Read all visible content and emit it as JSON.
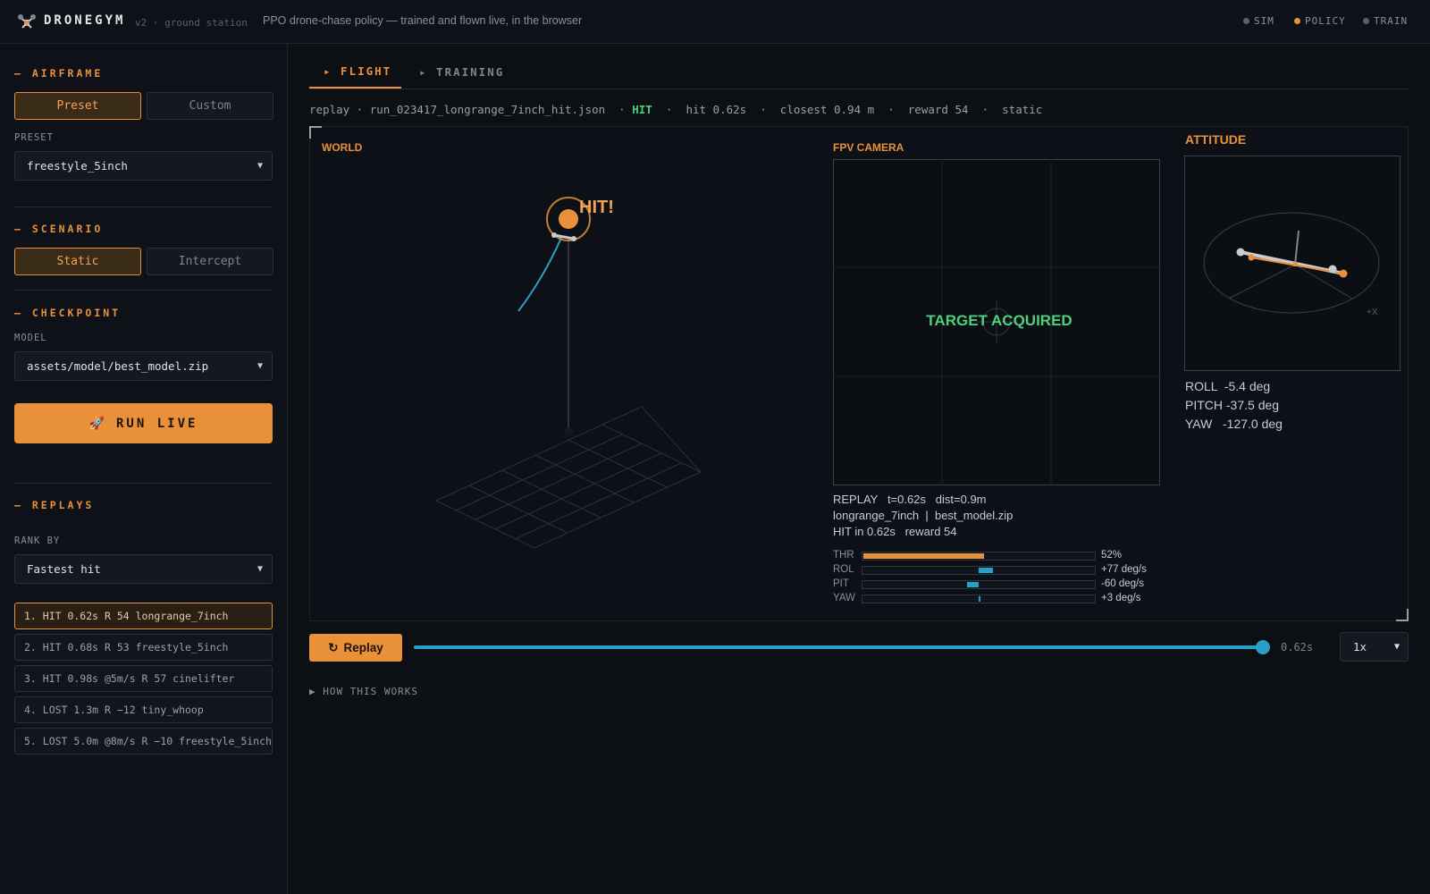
{
  "header": {
    "brand": "DRONEGYM",
    "version": "v2 · ground station",
    "tagline": "PPO drone-chase policy — trained and flown live, in the browser",
    "status": [
      {
        "label": "SIM",
        "color": "#5a616b"
      },
      {
        "label": "POLICY",
        "color": "#e8913a"
      },
      {
        "label": "TRAIN",
        "color": "#5a616b"
      }
    ]
  },
  "sidebar": {
    "airframe": {
      "title": "AIRFRAME",
      "preset_btn": "Preset",
      "custom_btn": "Custom",
      "preset_label": "PRESET",
      "preset_value": "freestyle_5inch"
    },
    "scenario": {
      "title": "SCENARIO",
      "static_btn": "Static",
      "intercept_btn": "Intercept"
    },
    "checkpoint": {
      "title": "CHECKPOINT",
      "model_label": "MODEL",
      "model_value": "assets/model/best_model.zip"
    },
    "run_live": "RUN LIVE",
    "replays": {
      "title": "REPLAYS",
      "rank_label": "RANK BY",
      "rank_value": "Fastest hit",
      "items": [
        "1. HIT 0.62s R 54 longrange_7inch",
        "2. HIT 0.68s R 53 freestyle_5inch",
        "3. HIT 0.98s @5m/s R 57 cinelifter",
        "4. LOST 1.3m R −12 tiny_whoop",
        "5. LOST 5.0m @8m/s R −10 freestyle_5inch"
      ]
    }
  },
  "main": {
    "tabs": [
      "▸ FLIGHT",
      "▸ TRAINING"
    ],
    "info": {
      "prefix": "replay · run_023417_longrange_7inch_hit.json  · ",
      "result": "HIT",
      "suffix": "  ·  hit 0.62s  ·  closest 0.94 m  ·  reward 54  ·  static"
    },
    "world": {
      "label": "WORLD",
      "hit_text": "HIT!"
    },
    "fpv": {
      "label": "FPV CAMERA",
      "acquired": "TARGET ACQUIRED",
      "line1": "REPLAY   t=0.62s   dist=0.9m",
      "line2": "longrange_7inch  |  best_model.zip",
      "line3": "HIT in 0.62s   reward 54",
      "bars": [
        {
          "label": "THR",
          "value": "52%",
          "fraction": 0.52,
          "centered": false,
          "color": "#e8913a"
        },
        {
          "label": "ROL",
          "value": "+77 deg/s",
          "fraction": 0.06,
          "centered": true,
          "color": "#2aa0c8"
        },
        {
          "label": "PIT",
          "value": "-60 deg/s",
          "fraction": -0.05,
          "centered": true,
          "color": "#2aa0c8"
        },
        {
          "label": "YAW",
          "value": "+3 deg/s",
          "fraction": 0.0,
          "centered": true,
          "color": "#2aa0c8"
        }
      ]
    },
    "attitude": {
      "label": "ATTITUDE",
      "axis_label": "+X",
      "roll": "ROLL  -5.4 deg",
      "pitch": "PITCH -37.5 deg",
      "yaw": "YAW   -127.0 deg"
    },
    "playback": {
      "replay_btn": "Replay",
      "time": "0.62s",
      "progress": 1.0,
      "speed": "1x"
    },
    "how": "HOW THIS WORKS"
  },
  "colors": {
    "accent": "#e8913a",
    "hit_green": "#4ed07a",
    "trail_blue": "#2aa0c8"
  }
}
